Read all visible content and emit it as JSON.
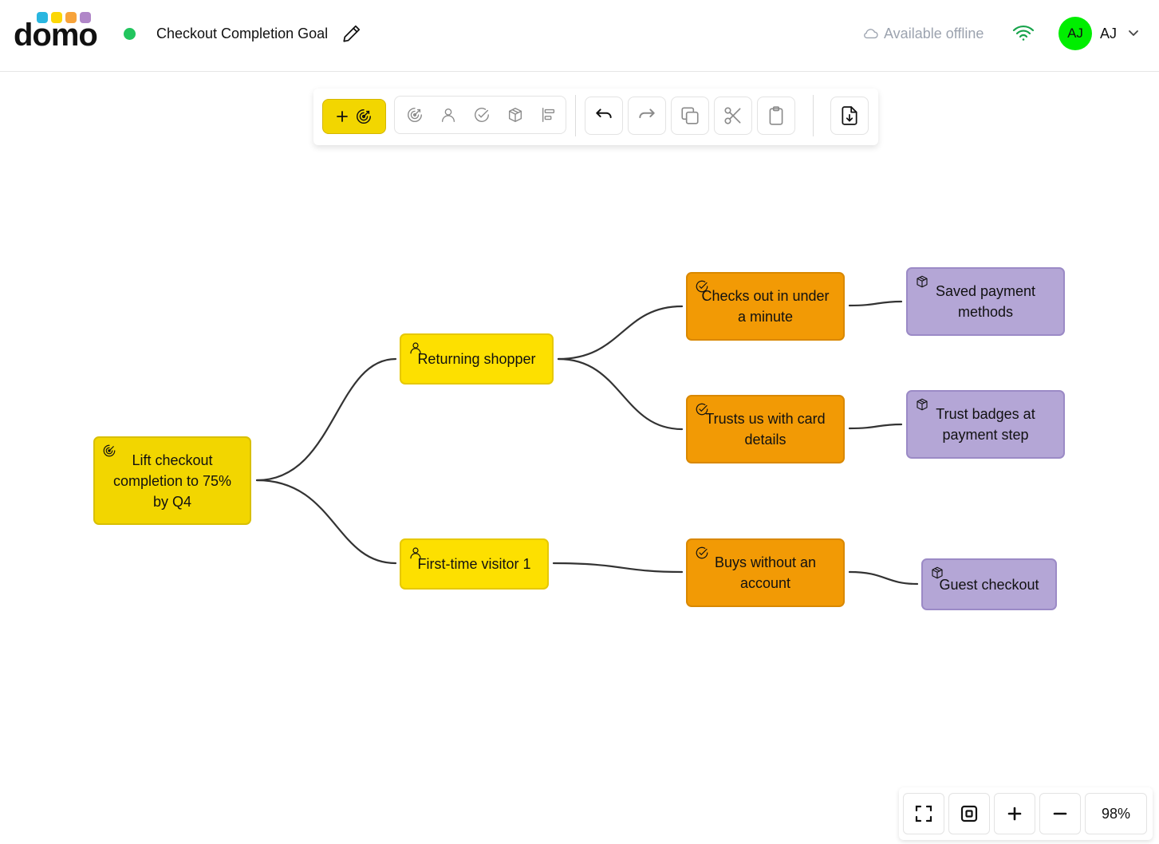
{
  "app": {
    "logo_text": "domo",
    "logo_colors": [
      "#29b6e0",
      "#fcd705",
      "#f7a33a",
      "#b086c8"
    ],
    "status_color": "#22c55e",
    "map_title": "Checkout Completion Goal"
  },
  "header": {
    "offline_label": "Available offline",
    "wifi_color": "#16a34a",
    "avatar_initials": "AJ",
    "avatar_color": "#00ee00",
    "user_name": "AJ"
  },
  "toolbar": {
    "add_button_color": "#f2d600",
    "node_types": [
      "goal-icon",
      "actor-icon",
      "impact-icon",
      "deliverable-icon",
      "align-icon"
    ],
    "actions": [
      "undo-icon",
      "redo-icon",
      "copy-icon",
      "cut-icon",
      "paste-icon",
      "export-icon"
    ]
  },
  "map": {
    "goal": {
      "label": "Lift checkout completion to 75% by Q4",
      "icon": "goal-icon",
      "color": "#f2d600"
    },
    "actors": [
      {
        "label": "Returning shopper",
        "icon": "actor-icon",
        "color": "#fde000"
      },
      {
        "label": "First-time visitor 1",
        "icon": "actor-icon",
        "color": "#fde000"
      }
    ],
    "impacts": [
      {
        "label": "Checks out in under a minute",
        "icon": "impact-icon",
        "color": "#f29a05"
      },
      {
        "label": "Trusts us with card details",
        "icon": "impact-icon",
        "color": "#f29a05"
      },
      {
        "label": "Buys without an account",
        "icon": "impact-icon",
        "color": "#f29a05"
      }
    ],
    "deliverables": [
      {
        "label": "Saved payment methods",
        "icon": "deliverable-icon",
        "color": "#b4a6d6"
      },
      {
        "label": "Trust badges at payment step",
        "icon": "deliverable-icon",
        "color": "#b4a6d6"
      },
      {
        "label": "Guest checkout",
        "icon": "deliverable-icon",
        "color": "#b4a6d6"
      }
    ]
  },
  "zoom": {
    "value": "98%",
    "buttons": [
      "fit-screen-icon",
      "center-icon",
      "zoom-in-icon",
      "zoom-out-icon"
    ]
  }
}
